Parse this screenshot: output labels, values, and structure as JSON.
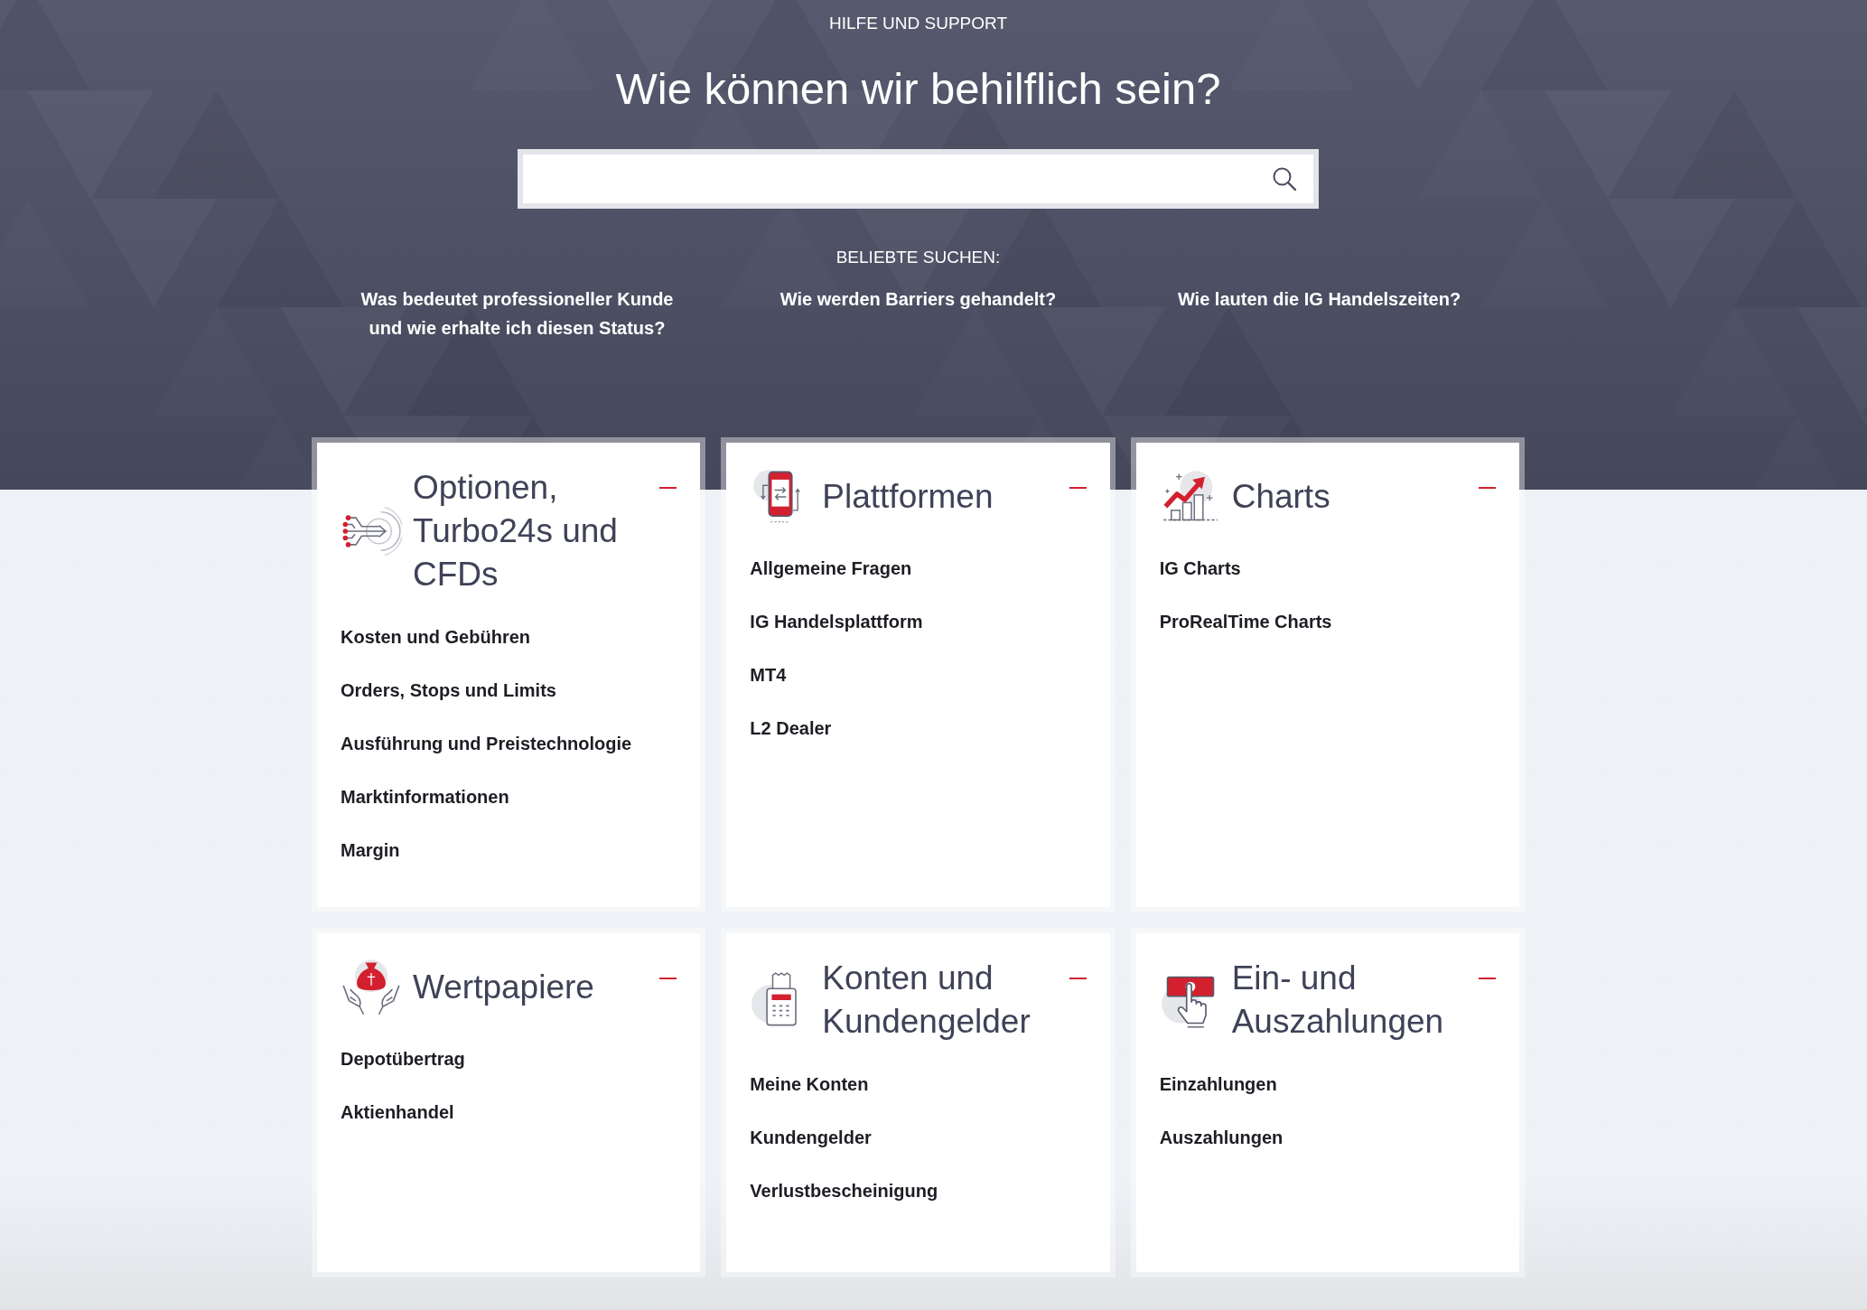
{
  "header": {
    "eyebrow": "HILFE UND SUPPORT",
    "title": "Wie können wir behilflich sein?"
  },
  "popular_searches": {
    "label": "BELIEBTE SUCHEN:",
    "links": [
      "Was bedeutet professioneller Kunde und wie erhalte ich diesen Status?",
      "Wie werden Barriers gehandelt?",
      "Wie lauten die IG Handelszeiten?"
    ]
  },
  "categories": [
    {
      "title": "Optionen, Turbo24s und CFDs",
      "expanded": true,
      "links": [
        "Kosten und Gebühren",
        "Orders, Stops und Limits",
        "Ausführung und Preistechnologie",
        "Marktinformationen",
        "Margin"
      ]
    },
    {
      "title": "Plattformen",
      "expanded": true,
      "links": [
        "Allgemeine Fragen",
        "IG Handelsplattform",
        "MT4",
        "L2 Dealer"
      ]
    },
    {
      "title": "Charts",
      "expanded": true,
      "links": [
        "IG Charts",
        "ProRealTime Charts"
      ]
    },
    {
      "title": "Wertpapiere",
      "expanded": true,
      "links": [
        "Depotübertrag",
        "Aktienhandel"
      ]
    },
    {
      "title": "Konten und Kundengelder",
      "expanded": true,
      "links": [
        "Meine Konten",
        "Kundengelder",
        "Verlustbescheinigung"
      ]
    },
    {
      "title": "Ein- und Auszahlungen",
      "expanded": true,
      "links": [
        "Einzahlungen",
        "Auszahlungen"
      ]
    }
  ]
}
